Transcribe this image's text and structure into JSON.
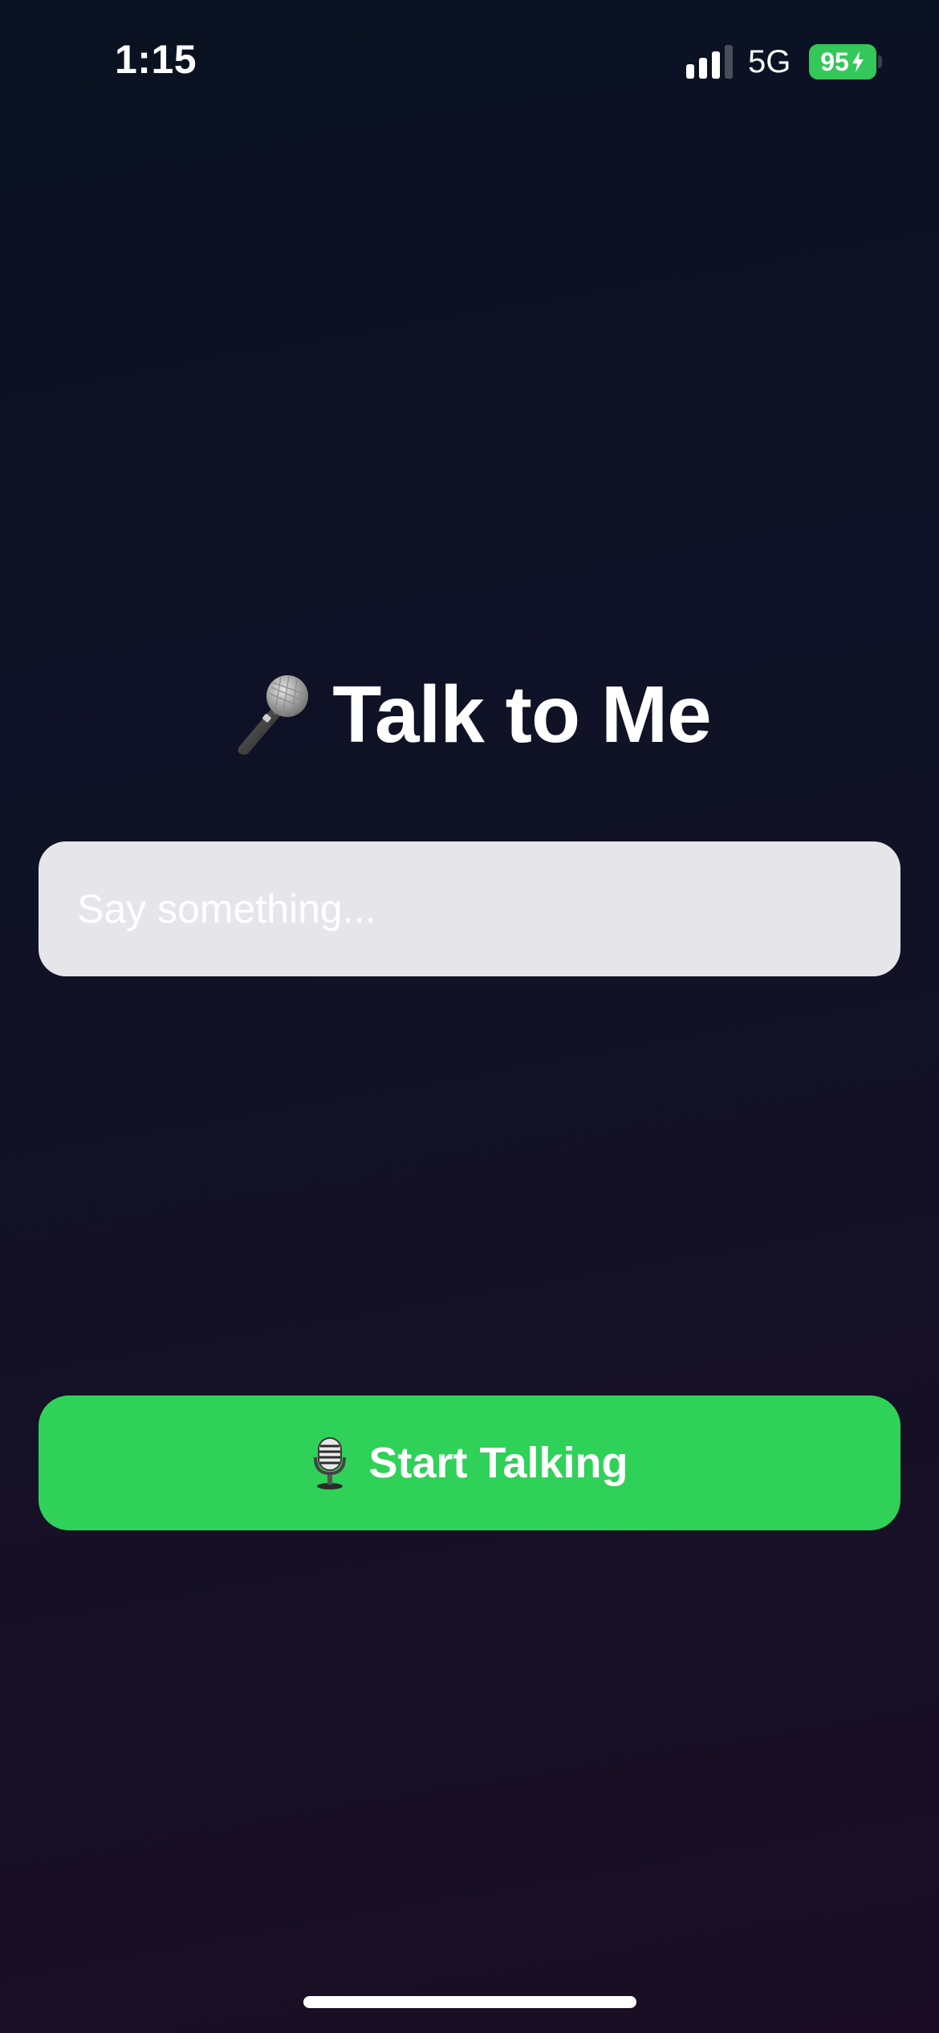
{
  "status_bar": {
    "time": "1:15",
    "network": "5G",
    "battery_level": "95",
    "battery_charging": true,
    "signal_bars_active": 3,
    "signal_bars_total": 4,
    "battery_color": "#34c759"
  },
  "header": {
    "icon": "microphone-icon",
    "title": "Talk to Me"
  },
  "speech_input": {
    "value": "",
    "placeholder": "Say something..."
  },
  "start_button": {
    "icon": "studio-microphone-icon",
    "label": "Start Talking",
    "color": "#30d158"
  }
}
